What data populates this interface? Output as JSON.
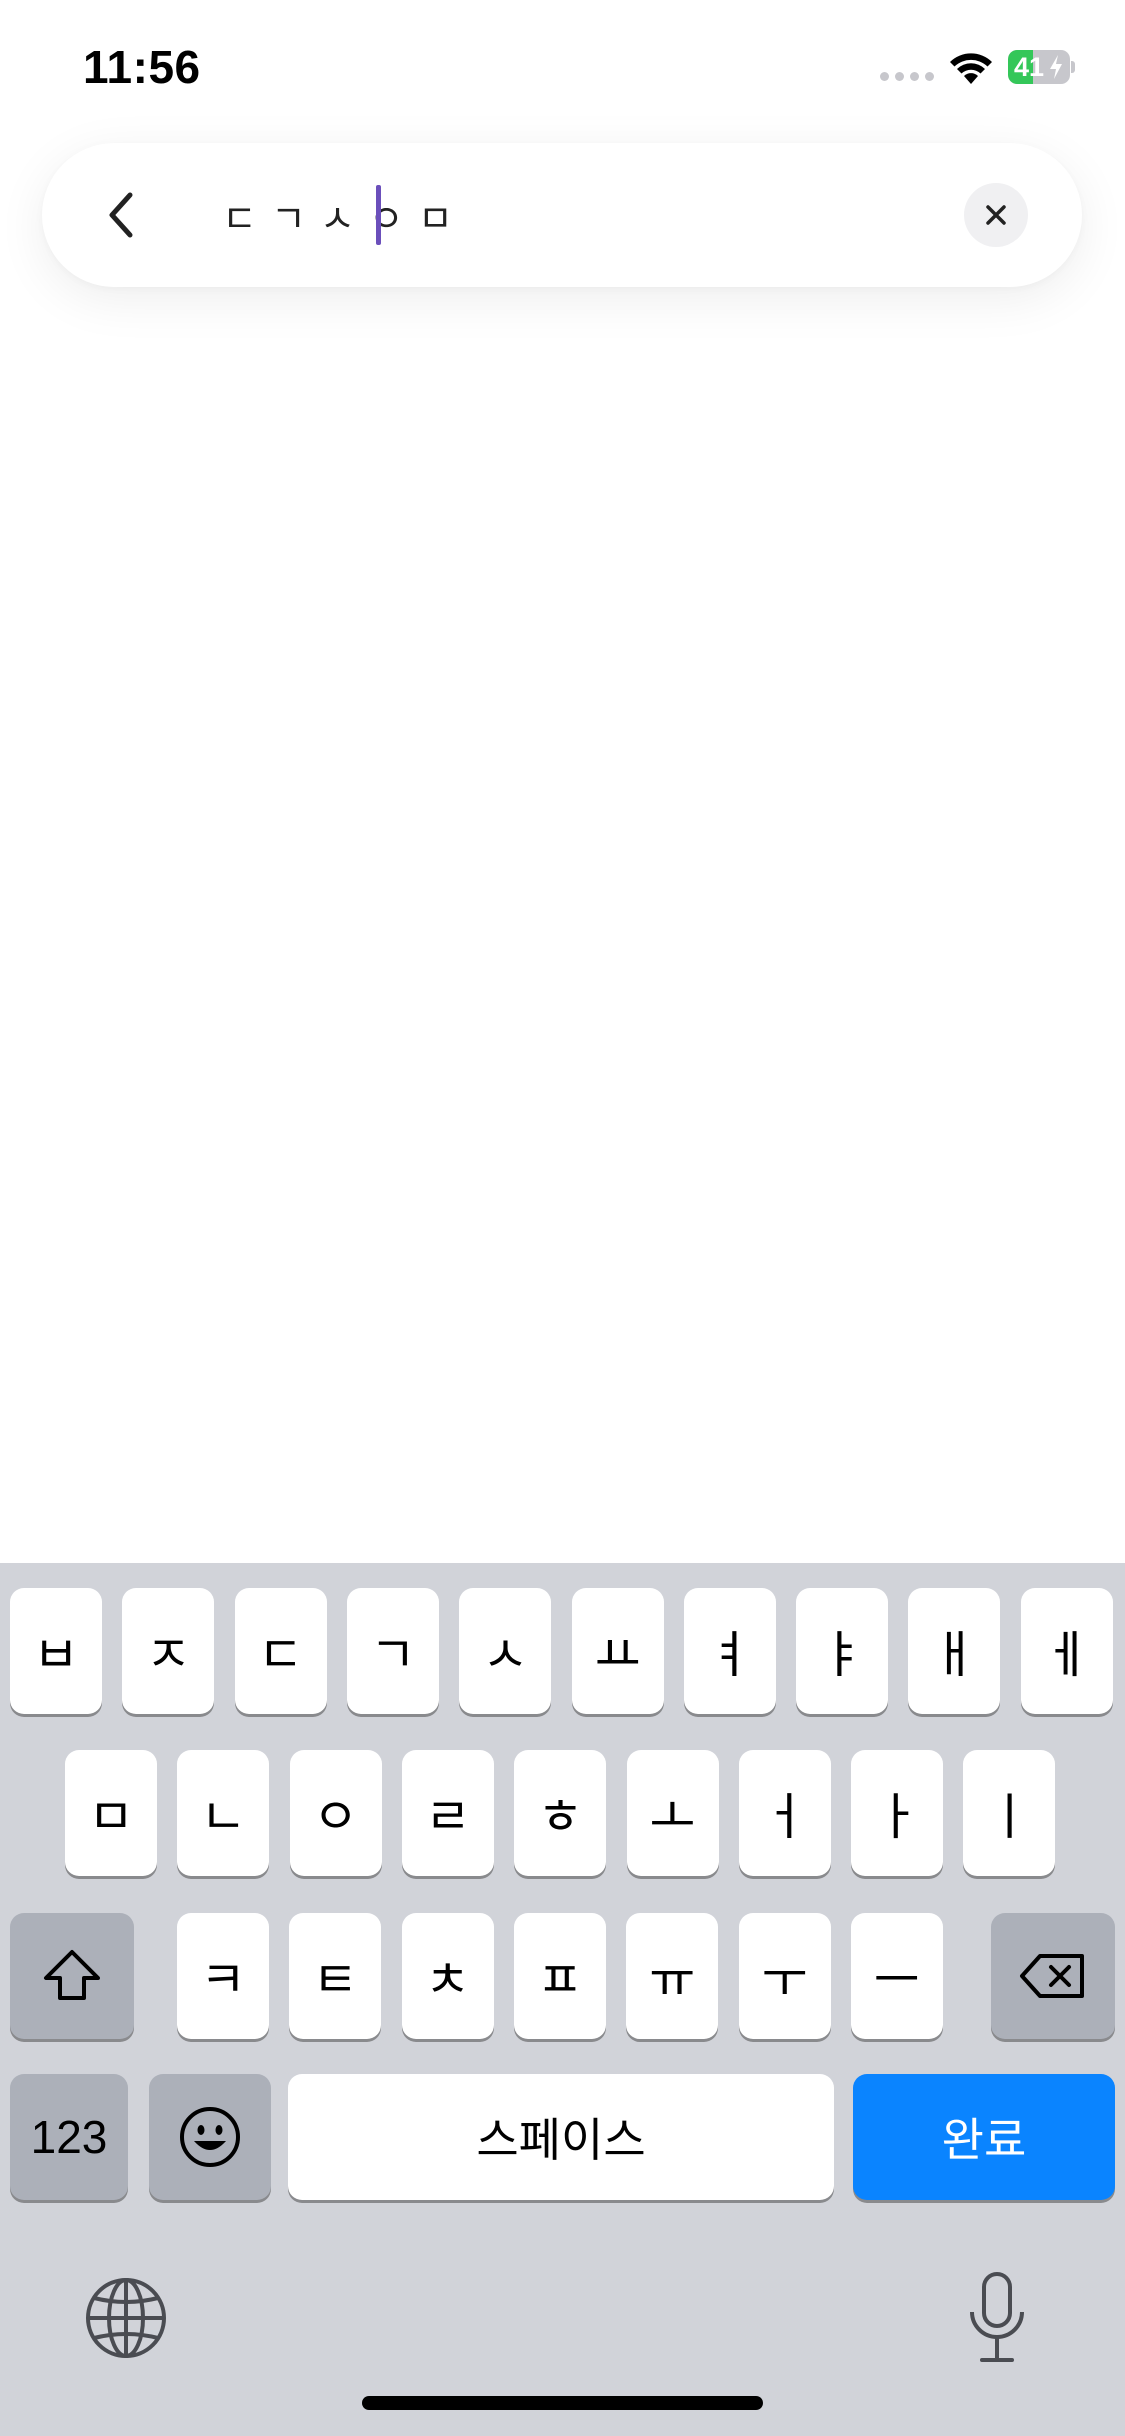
{
  "status_bar": {
    "time": "11:56",
    "battery_percent": "41",
    "battery_level": 0.41,
    "battery_color": "#34c759",
    "charging": true
  },
  "search": {
    "query": "ㄷㄱㅅㅇㅁ",
    "back_icon": "chevron-left-icon",
    "clear_icon": "close-icon",
    "caret_color": "#6b4fbb"
  },
  "keyboard": {
    "row1": [
      "ㅂ",
      "ㅈ",
      "ㄷ",
      "ㄱ",
      "ㅅ",
      "ㅛ",
      "ㅕ",
      "ㅑ",
      "ㅐ",
      "ㅔ"
    ],
    "row2": [
      "ㅁ",
      "ㄴ",
      "ㅇ",
      "ㄹ",
      "ㅎ",
      "ㅗ",
      "ㅓ",
      "ㅏ",
      "ㅣ"
    ],
    "row3": [
      "ㅋ",
      "ㅌ",
      "ㅊ",
      "ㅍ",
      "ㅠ",
      "ㅜ",
      "ㅡ"
    ],
    "numbers_label": "123",
    "space_label": "스페이스",
    "done_label": "완료",
    "shift_icon": "shift-icon",
    "backspace_icon": "backspace-icon",
    "emoji_icon": "emoji-icon",
    "globe_icon": "globe-icon",
    "mic_icon": "microphone-icon",
    "accent_color": "#0a84ff"
  }
}
